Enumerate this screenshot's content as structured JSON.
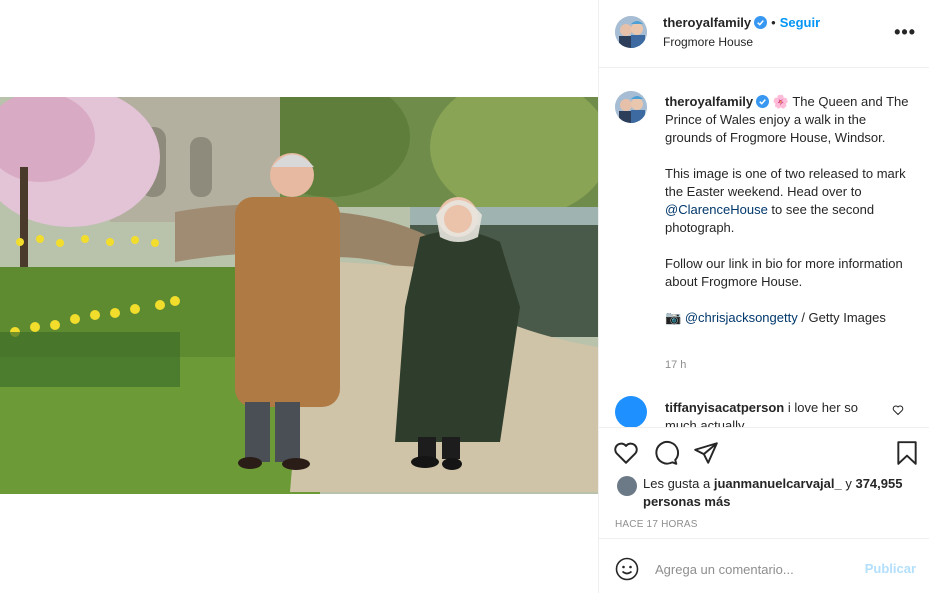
{
  "post": {
    "username": "theroyalfamily",
    "follow_label": "Seguir",
    "dot": "•",
    "location": "Frogmore House",
    "more_label": "•••"
  },
  "caption": {
    "username": "theroyalfamily",
    "emoji": "🌸",
    "p1": "The Queen and The Prince of Wales enjoy a walk in the grounds of Frogmore House, Windsor.",
    "p2_a": "This image is one of two released to mark the Easter weekend. Head over to ",
    "p2_mention": "@ClarenceHouse",
    "p2_b": " to see the second photograph.",
    "p3": "Follow our link in bio for more information about Frogmore House.",
    "camera": "📷",
    "credit_mention": "@chrisjacksongetty",
    "credit_rest": " / Getty Images",
    "time": "17 h"
  },
  "comment2": {
    "username": "tiffanyisacatperson",
    "text": "i love her so much actually"
  },
  "likes": {
    "prefix": "Les gusta a ",
    "user": "juanmanuelcarvajal_",
    "mid": " y ",
    "count": "374,955 personas más"
  },
  "timestamp": "HACE 17 HORAS",
  "add_comment": {
    "placeholder": "Agrega un comentario...",
    "publish_label": "Publicar"
  },
  "icons": [
    "heart-icon",
    "comment-icon",
    "share-icon",
    "bookmark-icon",
    "emoji-icon",
    "verified-icon",
    "more-icon"
  ],
  "colors": {
    "accent": "#0095f6",
    "mention": "#00376b",
    "muted": "#8e8e8e",
    "publish_disabled": "#b2dffc"
  }
}
